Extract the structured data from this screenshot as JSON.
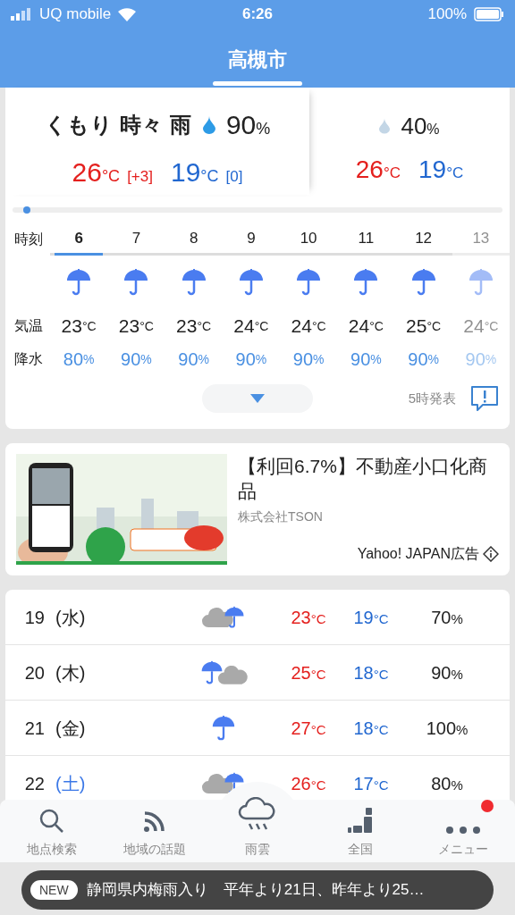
{
  "status_bar": {
    "carrier": "UQ mobile",
    "time": "6:26",
    "battery": "100%"
  },
  "header": {
    "title": "高槻市"
  },
  "today": {
    "weather": "くもり 時々 雨",
    "precip": "90%",
    "high": "26°C",
    "high_diff": "[+3]",
    "low": "19°C",
    "low_diff": "[0]"
  },
  "tomorrow": {
    "precip": "40%",
    "high": "26°C",
    "low": "19°C"
  },
  "timeline": {
    "level": 0.03
  },
  "hourly": {
    "labels": [
      "時刻",
      "気温",
      "降水"
    ],
    "hours": [
      {
        "hour": "6",
        "selected": true,
        "faded": false,
        "temp": "23°C",
        "precip": "80%"
      },
      {
        "hour": "7",
        "selected": false,
        "faded": false,
        "temp": "23°C",
        "precip": "90%"
      },
      {
        "hour": "8",
        "selected": false,
        "faded": false,
        "temp": "23°C",
        "precip": "90%"
      },
      {
        "hour": "9",
        "selected": false,
        "faded": false,
        "temp": "24°C",
        "precip": "90%"
      },
      {
        "hour": "10",
        "selected": false,
        "faded": false,
        "temp": "24°C",
        "precip": "90%"
      },
      {
        "hour": "11",
        "selected": false,
        "faded": false,
        "temp": "24°C",
        "precip": "90%"
      },
      {
        "hour": "12",
        "selected": false,
        "faded": false,
        "temp": "25°C",
        "precip": "90%"
      },
      {
        "hour": "13",
        "selected": false,
        "faded": true,
        "temp": "24°C",
        "precip": "90%"
      }
    ],
    "issued": "5時発表"
  },
  "ad": {
    "title": "【利回6.7%】不動産小口化商品",
    "sponsor": "株式会社TSON",
    "label": "Yahoo! JAPAN広告"
  },
  "daily": [
    {
      "date": "19",
      "weekday": "(水)",
      "color": "#222222",
      "kind": "cloud_rain",
      "high": "23°C",
      "low": "19°C",
      "precip": "70%"
    },
    {
      "date": "20",
      "weekday": "(木)",
      "color": "#222222",
      "kind": "rain_cloud",
      "high": "25°C",
      "low": "18°C",
      "precip": "90%"
    },
    {
      "date": "21",
      "weekday": "(金)",
      "color": "#222222",
      "kind": "rain",
      "high": "27°C",
      "low": "18°C",
      "precip": "100%"
    },
    {
      "date": "22",
      "weekday": "(土)",
      "color": "#3b78e7",
      "kind": "cloud_rain",
      "high": "26°C",
      "low": "17°C",
      "precip": "80%"
    }
  ],
  "nav": [
    {
      "label": "地点検索",
      "kind": "search",
      "notification": false
    },
    {
      "label": "地域の話題",
      "kind": "feed",
      "notification": false
    },
    {
      "label": "雨雲",
      "kind": "rain",
      "notification": false
    },
    {
      "label": "全国",
      "kind": "map",
      "notification": false
    },
    {
      "label": "メニュー",
      "kind": "more",
      "notification": true
    }
  ],
  "toast": {
    "tag": "NEW",
    "text": "静岡県内梅雨入り　平年より21日、昨年より25…"
  }
}
